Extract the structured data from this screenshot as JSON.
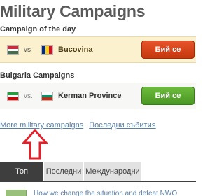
{
  "page": {
    "title": "Military Campaigns"
  },
  "campaign_of_day": {
    "heading": "Campaign of the day",
    "attacker_flag": "hungary-flag",
    "vs": "vs",
    "defender_flag": "romania-flag",
    "region": "Bucovina",
    "button_label": "Бий се",
    "accent_color": "#d5441a"
  },
  "country_campaigns": {
    "heading": "Bulgaria Campaigns",
    "attacker_flag": "iran-flag",
    "vs": "vs.",
    "defender_flag": "bulgaria-flag",
    "region": "Kerman Province",
    "button_label": "Бий се",
    "accent_color": "#5aa62f"
  },
  "links": {
    "more_campaigns": "More military campaigns",
    "latest_events": "Последни събития"
  },
  "annotation": {
    "arrow_icon": "up-arrow-icon",
    "color": "#e0202a"
  },
  "tabs": [
    {
      "label": "Топ",
      "active": true
    },
    {
      "label": "Последни",
      "active": false
    },
    {
      "label": "Международни",
      "active": false
    }
  ],
  "news": {
    "text": "How we change the situation and defeat NWO"
  }
}
